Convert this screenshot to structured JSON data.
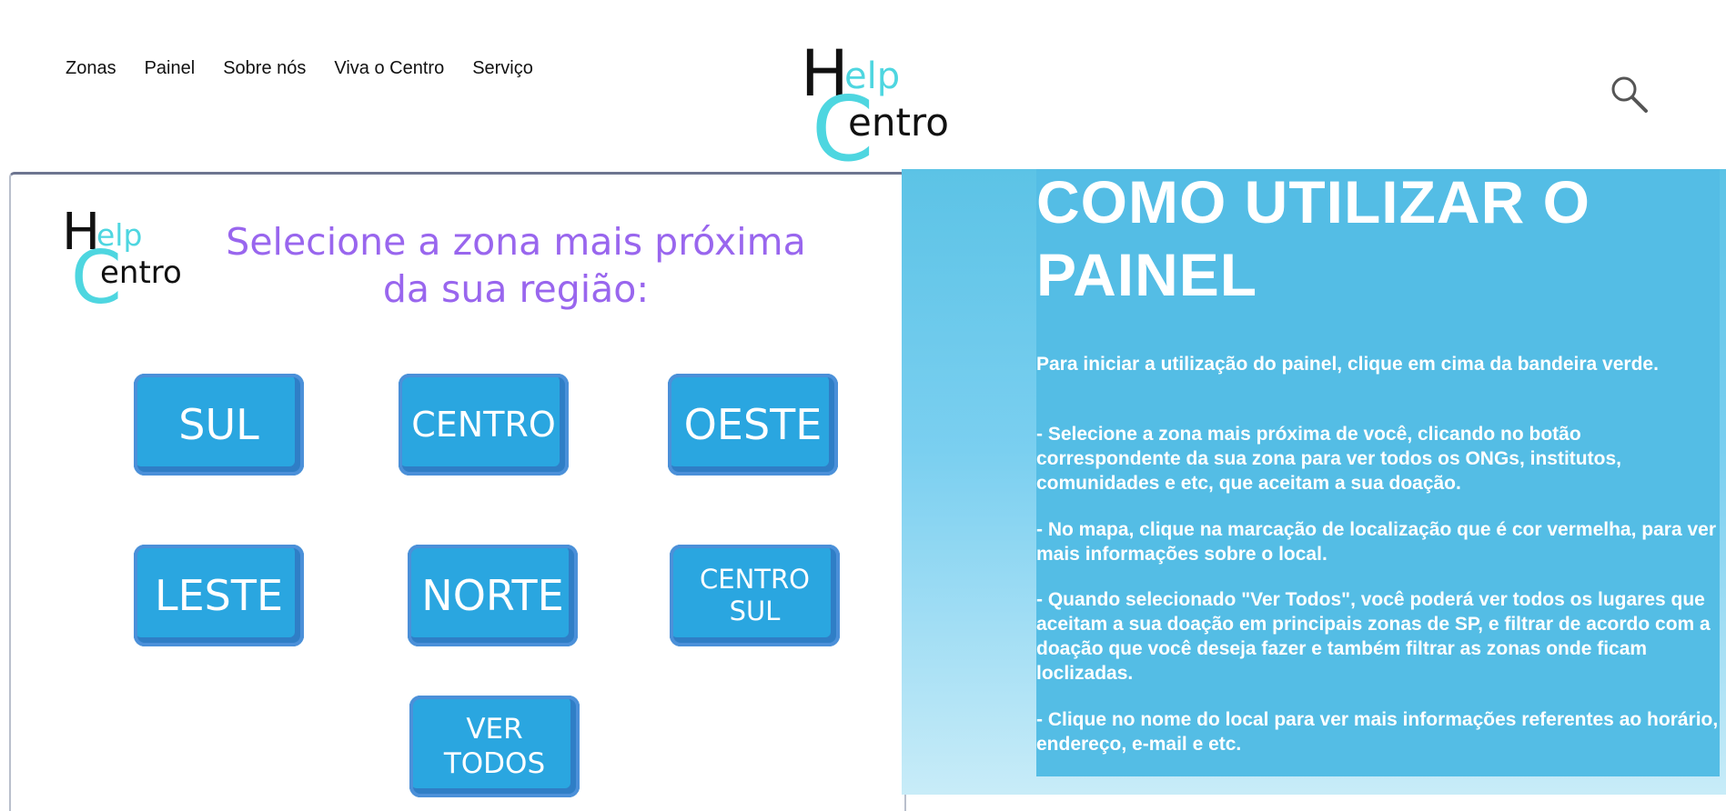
{
  "nav": {
    "items": [
      "Zonas",
      "Painel",
      "Sobre nós",
      "Viva o Centro",
      "Serviço"
    ]
  },
  "logo": {
    "h": "H",
    "elp": "elp",
    "c": "C",
    "entro": "entro"
  },
  "panel": {
    "title": "Selecione a zona mais próxima da sua região:",
    "zones": [
      "SUL",
      "CENTRO",
      "OESTE",
      "LESTE",
      "NORTE",
      "CENTRO\nSUL",
      "VER\nTODOS"
    ]
  },
  "info": {
    "title": "COMO UTILIZAR O PAINEL",
    "paragraphs": [
      "Para iniciar a utilização do painel, clique em cima da bandeira verde.",
      "- Selecione a zona mais próxima de você, clicando no botão correspondente da sua zona para ver todos os ONGs, institutos, comunidades e etc, que aceitam a sua doação.",
      "- No mapa, clique na marcação de localização que é cor vermelha, para ver mais informações sobre o local.",
      "- Quando selecionado \"Ver Todos\", você poderá ver todos os lugares que aceitam a sua doação em principais zonas de SP, e filtrar de acordo com a doação que você deseja fazer e também filtrar as zonas onde ficam loclizadas.",
      "- Clique no nome do local para ver mais informações referentes ao horário, endereço, e-mail e etc."
    ]
  },
  "icons": {
    "search": "search-icon"
  },
  "colors": {
    "accent": "#2aa6e0",
    "title": "#9966ee",
    "info_bg": "#54bde5",
    "logo_cyan": "#4ed6e0"
  }
}
